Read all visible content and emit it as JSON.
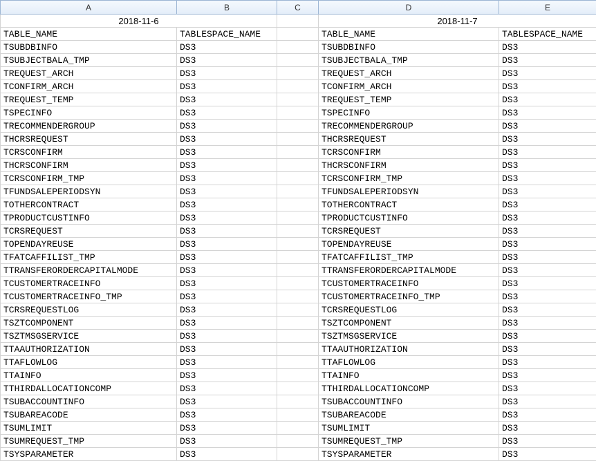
{
  "columns": [
    "A",
    "B",
    "C",
    "D",
    "E"
  ],
  "dateHeaders": {
    "left": "2018-11-6",
    "right": "2018-11-7"
  },
  "subHeaders": {
    "A": "TABLE_NAME",
    "B": "TABLESPACE_NAME",
    "D": "TABLE_NAME",
    "E": "TABLESPACE_NAME"
  },
  "rows": [
    {
      "A": "TSUBDBINFO",
      "B": "DS3",
      "D": "TSUBDBINFO",
      "E": "DS3"
    },
    {
      "A": "TSUBJECTBALA_TMP",
      "B": "DS3",
      "D": "TSUBJECTBALA_TMP",
      "E": "DS3"
    },
    {
      "A": "TREQUEST_ARCH",
      "B": "DS3",
      "D": "TREQUEST_ARCH",
      "E": "DS3"
    },
    {
      "A": "TCONFIRM_ARCH",
      "B": "DS3",
      "D": "TCONFIRM_ARCH",
      "E": "DS3"
    },
    {
      "A": "TREQUEST_TEMP",
      "B": "DS3",
      "D": "TREQUEST_TEMP",
      "E": "DS3"
    },
    {
      "A": "TSPECINFO",
      "B": "DS3",
      "D": "TSPECINFO",
      "E": "DS3"
    },
    {
      "A": "TRECOMMENDERGROUP",
      "B": "DS3",
      "D": "TRECOMMENDERGROUP",
      "E": "DS3"
    },
    {
      "A": "THCRSREQUEST",
      "B": "DS3",
      "D": "THCRSREQUEST",
      "E": "DS3"
    },
    {
      "A": "TCRSCONFIRM",
      "B": "DS3",
      "D": "TCRSCONFIRM",
      "E": "DS3"
    },
    {
      "A": "THCRSCONFIRM",
      "B": "DS3",
      "D": "THCRSCONFIRM",
      "E": "DS3"
    },
    {
      "A": "TCRSCONFIRM_TMP",
      "B": "DS3",
      "D": "TCRSCONFIRM_TMP",
      "E": "DS3"
    },
    {
      "A": "TFUNDSALEPERIODSYN",
      "B": "DS3",
      "D": "TFUNDSALEPERIODSYN",
      "E": "DS3"
    },
    {
      "A": "TOTHERCONTRACT",
      "B": "DS3",
      "D": "TOTHERCONTRACT",
      "E": "DS3"
    },
    {
      "A": "TPRODUCTCUSTINFO",
      "B": "DS3",
      "D": "TPRODUCTCUSTINFO",
      "E": "DS3"
    },
    {
      "A": "TCRSREQUEST",
      "B": "DS3",
      "D": "TCRSREQUEST",
      "E": "DS3"
    },
    {
      "A": "TOPENDAYREUSE",
      "B": "DS3",
      "D": "TOPENDAYREUSE",
      "E": "DS3"
    },
    {
      "A": "TFATCAFFILIST_TMP",
      "B": "DS3",
      "D": "TFATCAFFILIST_TMP",
      "E": "DS3"
    },
    {
      "A": "TTRANSFERORDERCAPITALMODE",
      "B": "DS3",
      "D": "TTRANSFERORDERCAPITALMODE",
      "E": "DS3"
    },
    {
      "A": "TCUSTOMERTRACEINFO",
      "B": "DS3",
      "D": "TCUSTOMERTRACEINFO",
      "E": "DS3"
    },
    {
      "A": "TCUSTOMERTRACEINFO_TMP",
      "B": "DS3",
      "D": "TCUSTOMERTRACEINFO_TMP",
      "E": "DS3"
    },
    {
      "A": "TCRSREQUESTLOG",
      "B": "DS3",
      "D": "TCRSREQUESTLOG",
      "E": "DS3"
    },
    {
      "A": "TSZTCOMPONENT",
      "B": "DS3",
      "D": "TSZTCOMPONENT",
      "E": "DS3"
    },
    {
      "A": "TSZTMSGSERVICE",
      "B": "DS3",
      "D": "TSZTMSGSERVICE",
      "E": "DS3"
    },
    {
      "A": "TTAAUTHORIZATION",
      "B": "DS3",
      "D": "TTAAUTHORIZATION",
      "E": "DS3"
    },
    {
      "A": "TTAFLOWLOG",
      "B": "DS3",
      "D": "TTAFLOWLOG",
      "E": "DS3"
    },
    {
      "A": "TTAINFO",
      "B": "DS3",
      "D": "TTAINFO",
      "E": "DS3"
    },
    {
      "A": "TTHIRDALLOCATIONCOMP",
      "B": "DS3",
      "D": "TTHIRDALLOCATIONCOMP",
      "E": "DS3"
    },
    {
      "A": "TSUBACCOUNTINFO",
      "B": "DS3",
      "D": "TSUBACCOUNTINFO",
      "E": "DS3"
    },
    {
      "A": "TSUBAREACODE",
      "B": "DS3",
      "D": "TSUBAREACODE",
      "E": "DS3"
    },
    {
      "A": "TSUMLIMIT",
      "B": "DS3",
      "D": "TSUMLIMIT",
      "E": "DS3"
    },
    {
      "A": "TSUMREQUEST_TMP",
      "B": "DS3",
      "D": "TSUMREQUEST_TMP",
      "E": "DS3"
    },
    {
      "A": "TSYSPARAMETER",
      "B": "DS3",
      "D": "TSYSPARAMETER",
      "E": "DS3"
    }
  ]
}
